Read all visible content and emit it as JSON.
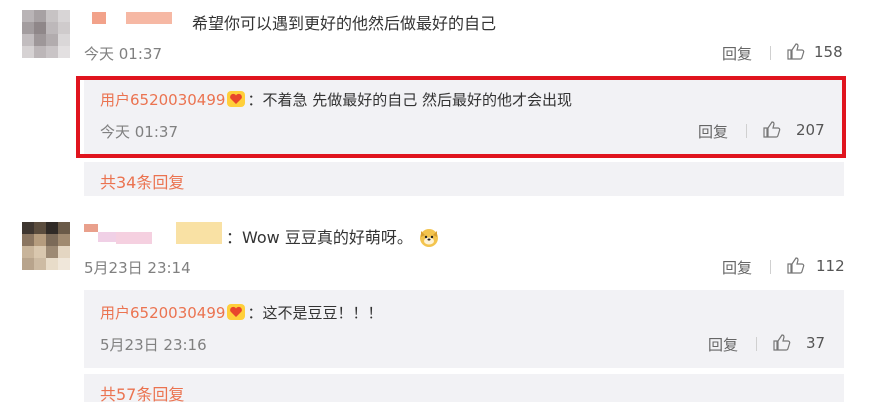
{
  "comment1": {
    "text": "希望你可以遇到更好的他然后做最好的自己",
    "time": "今天 01:37",
    "reply_label": "回复",
    "likes": "158"
  },
  "reply1": {
    "user": "用户6520030499",
    "text": "：不着急 先做最好的自己 然后最好的他才会出现",
    "time": "今天 01:37",
    "reply_label": "回复",
    "likes": "207"
  },
  "more1": "共34条回复",
  "comment2": {
    "text": "：Wow 豆豆真的好萌呀。",
    "time": "5月23日 23:14",
    "reply_label": "回复",
    "likes": "112"
  },
  "reply2": {
    "user": "用户6520030499",
    "text": "：这不是豆豆！！！",
    "time": "5月23日 23:16",
    "reply_label": "回复",
    "likes": "37"
  },
  "more2": "共57条回复",
  "colors": {
    "highlight": "#e0141e",
    "username": "#eb7350",
    "reply_bg": "#f2f2f5"
  },
  "icons": [
    "thumbs-up-icon",
    "heart-badge-icon",
    "dog-emoji-icon"
  ]
}
